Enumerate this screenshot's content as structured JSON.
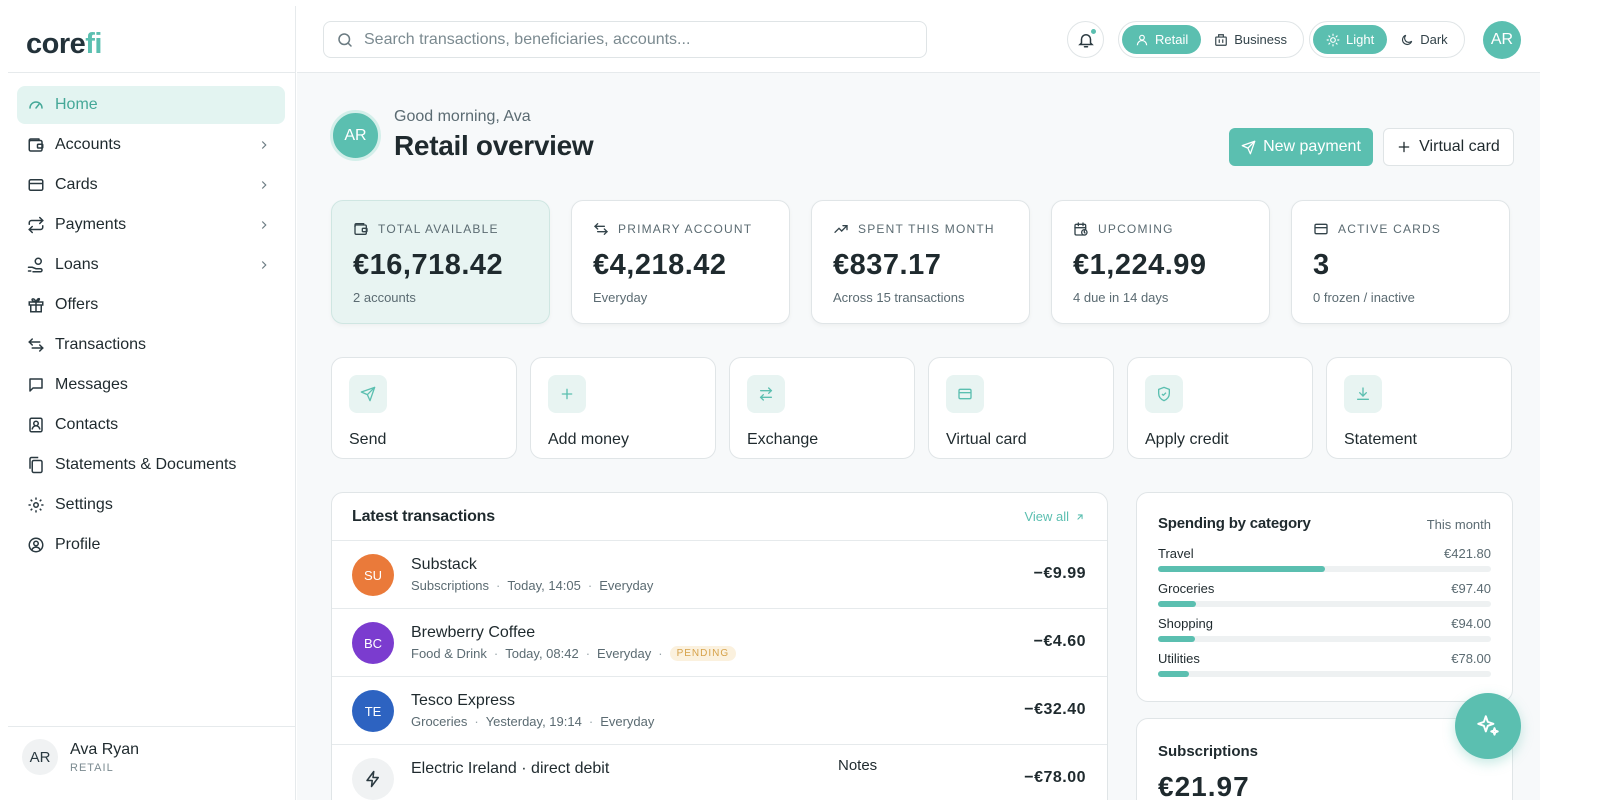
{
  "brand": {
    "name_a": "core",
    "name_b": "fi",
    "accent": "#5bbfb0"
  },
  "sidebar": {
    "items": [
      {
        "label": "Home",
        "icon": "gauge-icon",
        "active": true,
        "chevron": false
      },
      {
        "label": "Accounts",
        "icon": "wallet-icon",
        "chevron": true
      },
      {
        "label": "Cards",
        "icon": "credit-card-icon",
        "chevron": true
      },
      {
        "label": "Payments",
        "icon": "repeat-icon",
        "chevron": true
      },
      {
        "label": "Loans",
        "icon": "hand-coins-icon",
        "chevron": true
      },
      {
        "label": "Offers",
        "icon": "gift-icon",
        "chevron": false
      },
      {
        "label": "Transactions",
        "icon": "arrows-swap-icon",
        "chevron": false
      },
      {
        "label": "Messages",
        "icon": "message-icon",
        "chevron": false
      },
      {
        "label": "Contacts",
        "icon": "contact-icon",
        "chevron": false
      },
      {
        "label": "Statements & Documents",
        "icon": "documents-icon",
        "chevron": false
      },
      {
        "label": "Settings",
        "icon": "gear-icon",
        "chevron": false
      },
      {
        "label": "Profile",
        "icon": "user-circle-icon",
        "chevron": false
      }
    ],
    "user": {
      "initials": "AR",
      "name": "Ava Ryan",
      "role": "RETAIL"
    }
  },
  "topbar": {
    "search_placeholder": "Search transactions, beneficiaries, accounts...",
    "mode": {
      "retail": "Retail",
      "business": "Business",
      "selected": "Retail"
    },
    "theme": {
      "light": "Light",
      "dark": "Dark",
      "selected": "Light"
    },
    "avatar_initials": "AR"
  },
  "header": {
    "avatar_initials": "AR",
    "greeting": "Good morning, Ava",
    "title": "Retail overview",
    "new_payment": "New payment",
    "virtual_card": "Virtual card"
  },
  "stats": [
    {
      "label": "TOTAL AVAILABLE",
      "value": "€16,718.42",
      "sub": "2 accounts",
      "icon": "wallet-icon"
    },
    {
      "label": "PRIMARY ACCOUNT",
      "value": "€4,218.42",
      "sub": "Everyday",
      "icon": "arrows-swap-icon"
    },
    {
      "label": "SPENT THIS MONTH",
      "value": "€837.17",
      "sub": "Across 15 transactions",
      "icon": "trend-up-icon"
    },
    {
      "label": "UPCOMING",
      "value": "€1,224.99",
      "sub": "4 due in 14 days",
      "icon": "calendar-clock-icon"
    },
    {
      "label": "ACTIVE CARDS",
      "value": "3",
      "sub": "0 frozen / inactive",
      "icon": "credit-card-icon"
    }
  ],
  "quick_actions": [
    {
      "label": "Send",
      "icon": "send-icon"
    },
    {
      "label": "Add money",
      "icon": "plus-icon"
    },
    {
      "label": "Exchange",
      "icon": "exchange-icon"
    },
    {
      "label": "Virtual card",
      "icon": "credit-card-icon"
    },
    {
      "label": "Apply credit",
      "icon": "shield-check-icon"
    },
    {
      "label": "Statement",
      "icon": "download-icon"
    }
  ],
  "transactions": {
    "title": "Latest transactions",
    "view_all": "View all",
    "rows": [
      {
        "initials": "SU",
        "color": "#ea7a3a",
        "name": "Substack",
        "category": "Subscriptions",
        "time": "Today, 14:05",
        "account": "Everyday",
        "status": "",
        "amount": "−€9.99"
      },
      {
        "initials": "BC",
        "color": "#7b3ccf",
        "name": "Brewberry Coffee",
        "category": "Food & Drink",
        "time": "Today, 08:42",
        "account": "Everyday",
        "status": "PENDING",
        "amount": "−€4.60"
      },
      {
        "initials": "TE",
        "color": "#2d63c1",
        "name": "Tesco Express",
        "category": "Groceries",
        "time": "Yesterday, 19:14",
        "account": "Everyday",
        "status": "",
        "amount": "−€32.40"
      },
      {
        "initials": "",
        "color": "#f0f2f3",
        "name": "Electric Ireland · direct debit",
        "category": "",
        "time": "",
        "account": "",
        "status": "",
        "amount": "−€78.00"
      }
    ]
  },
  "spending": {
    "title": "Spending by category",
    "period": "This month",
    "max": 421.8,
    "categories": [
      {
        "name": "Travel",
        "amount": "€421.80",
        "value": 421.8
      },
      {
        "name": "Groceries",
        "amount": "€97.40",
        "value": 97.4
      },
      {
        "name": "Shopping",
        "amount": "€94.00",
        "value": 94.0
      },
      {
        "name": "Utilities",
        "amount": "€78.00",
        "value": 78.0
      }
    ]
  },
  "subscriptions": {
    "title": "Subscriptions",
    "value": "€21.97"
  },
  "overlay": {
    "notes": "Notes"
  }
}
